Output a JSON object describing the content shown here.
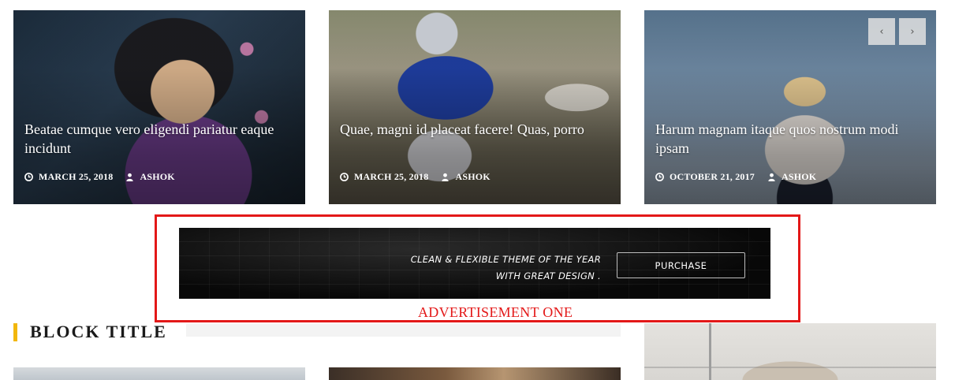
{
  "slider": {
    "prev_icon": "‹",
    "next_icon": "›",
    "cards": [
      {
        "title": "Beatae cumque vero eligendi pariatur eaque incidunt",
        "date": "MARCH 25, 2018",
        "author": "ASHOK"
      },
      {
        "title": "Quae, magni id placeat facere! Quas, porro",
        "date": "MARCH 25, 2018",
        "author": "ASHOK"
      },
      {
        "title": "Harum magnam itaque quos nostrum modi ipsam",
        "date": "OCTOBER 21, 2017",
        "author": "ASHOK"
      }
    ]
  },
  "advertisement": {
    "line1": "CLEAN & FLEXIBLE THEME OF THE YEAR",
    "line2": "WITH GREAT DESIGN .",
    "button": "PURCHASE",
    "label": "ADVERTISEMENT ONE"
  },
  "block": {
    "title": "BLOCK TITLE",
    "accent_color": "#f2b70c"
  },
  "colors": {
    "ad_frame": "#e31818"
  }
}
